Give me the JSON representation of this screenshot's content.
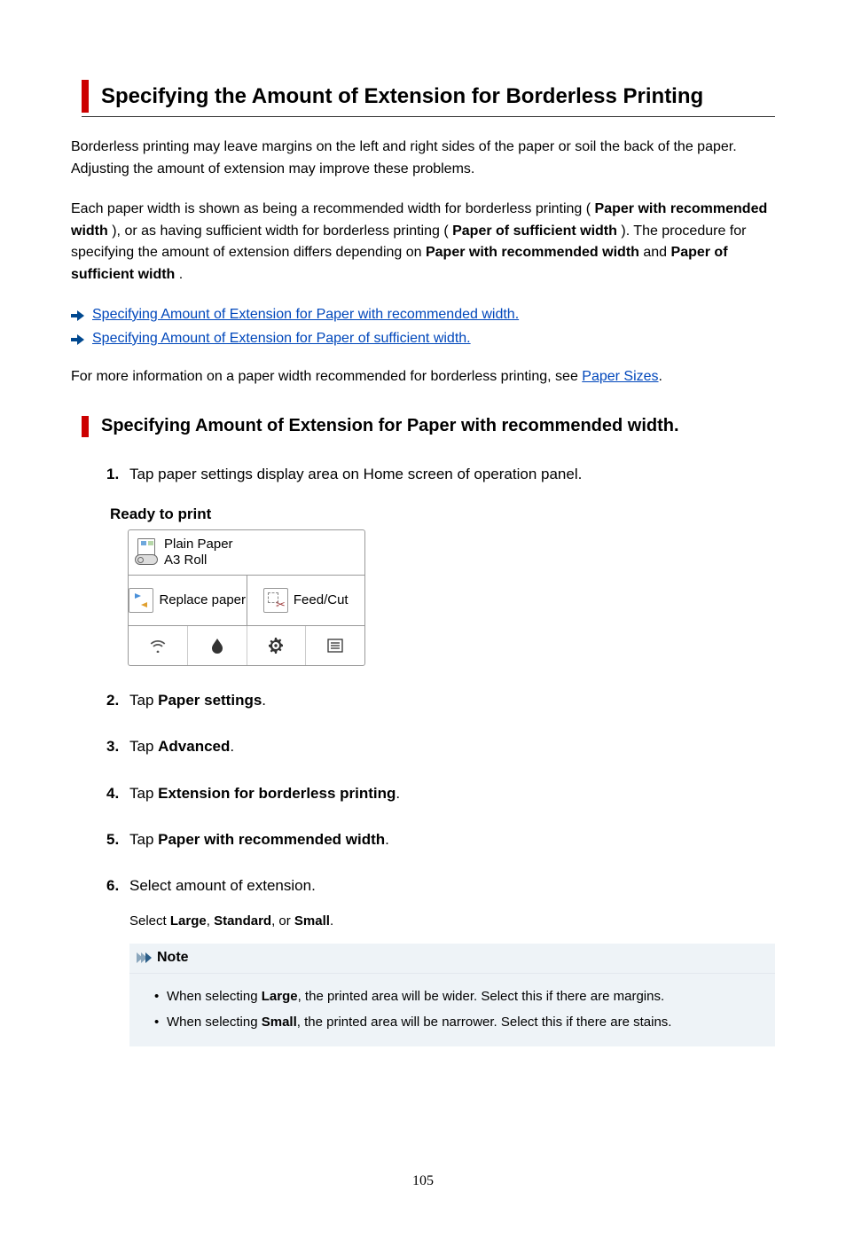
{
  "title": "Specifying the Amount of Extension for Borderless Printing",
  "intro1": "Borderless printing may leave margins on the left and right sides of the paper or soil the back of the paper. Adjusting the amount of extension may improve these problems.",
  "intro2_pre": "Each paper width is shown as being a recommended width for borderless printing ( ",
  "intro2_b1": "Paper with recommended width",
  "intro2_mid": " ), or as having sufficient width for borderless printing ( ",
  "intro2_b2": "Paper of sufficient width",
  "intro2_mid2": " ). The procedure for specifying the amount of extension differs depending on ",
  "intro2_b3": "Paper with recommended width",
  "intro2_and": " and ",
  "intro2_b4": "Paper of sufficient width",
  "intro2_end": ".",
  "toc": {
    "link1": "Specifying Amount of Extension for Paper with recommended width.",
    "link2": "Specifying Amount of Extension for Paper of sufficient width."
  },
  "moreinfo_pre": "For more information on a paper width recommended for borderless printing, see ",
  "moreinfo_link": "Paper Sizes",
  "moreinfo_post": ".",
  "subhead": "Specifying Amount of Extension for Paper with recommended width.",
  "panel": {
    "status": "Ready to print",
    "paper_type": "Plain Paper",
    "paper_size": "A3 Roll",
    "replace": "Replace paper",
    "feedcut": "Feed/Cut"
  },
  "steps": {
    "s1": "Tap paper settings display area on Home screen of operation panel.",
    "s2_pre": "Tap ",
    "s2_b": "Paper settings",
    "s2_post": ".",
    "s3_pre": "Tap ",
    "s3_b": "Advanced",
    "s3_post": ".",
    "s4_pre": "Tap ",
    "s4_b": "Extension for borderless printing",
    "s4_post": ".",
    "s5_pre": "Tap ",
    "s5_b": "Paper with recommended width",
    "s5_post": ".",
    "s6": "Select amount of extension.",
    "s6_sub_pre": "Select ",
    "s6_sub_b1": "Large",
    "s6_sub_c1": ", ",
    "s6_sub_b2": "Standard",
    "s6_sub_c2": ", or ",
    "s6_sub_b3": "Small",
    "s6_sub_post": "."
  },
  "note": {
    "label": "Note",
    "b1_pre": "When selecting ",
    "b1_b": "Large",
    "b1_post": ", the printed area will be wider. Select this if there are margins.",
    "b2_pre": "When selecting ",
    "b2_b": "Small",
    "b2_post": ", the printed area will be narrower. Select this if there are stains."
  },
  "page_number": "105"
}
